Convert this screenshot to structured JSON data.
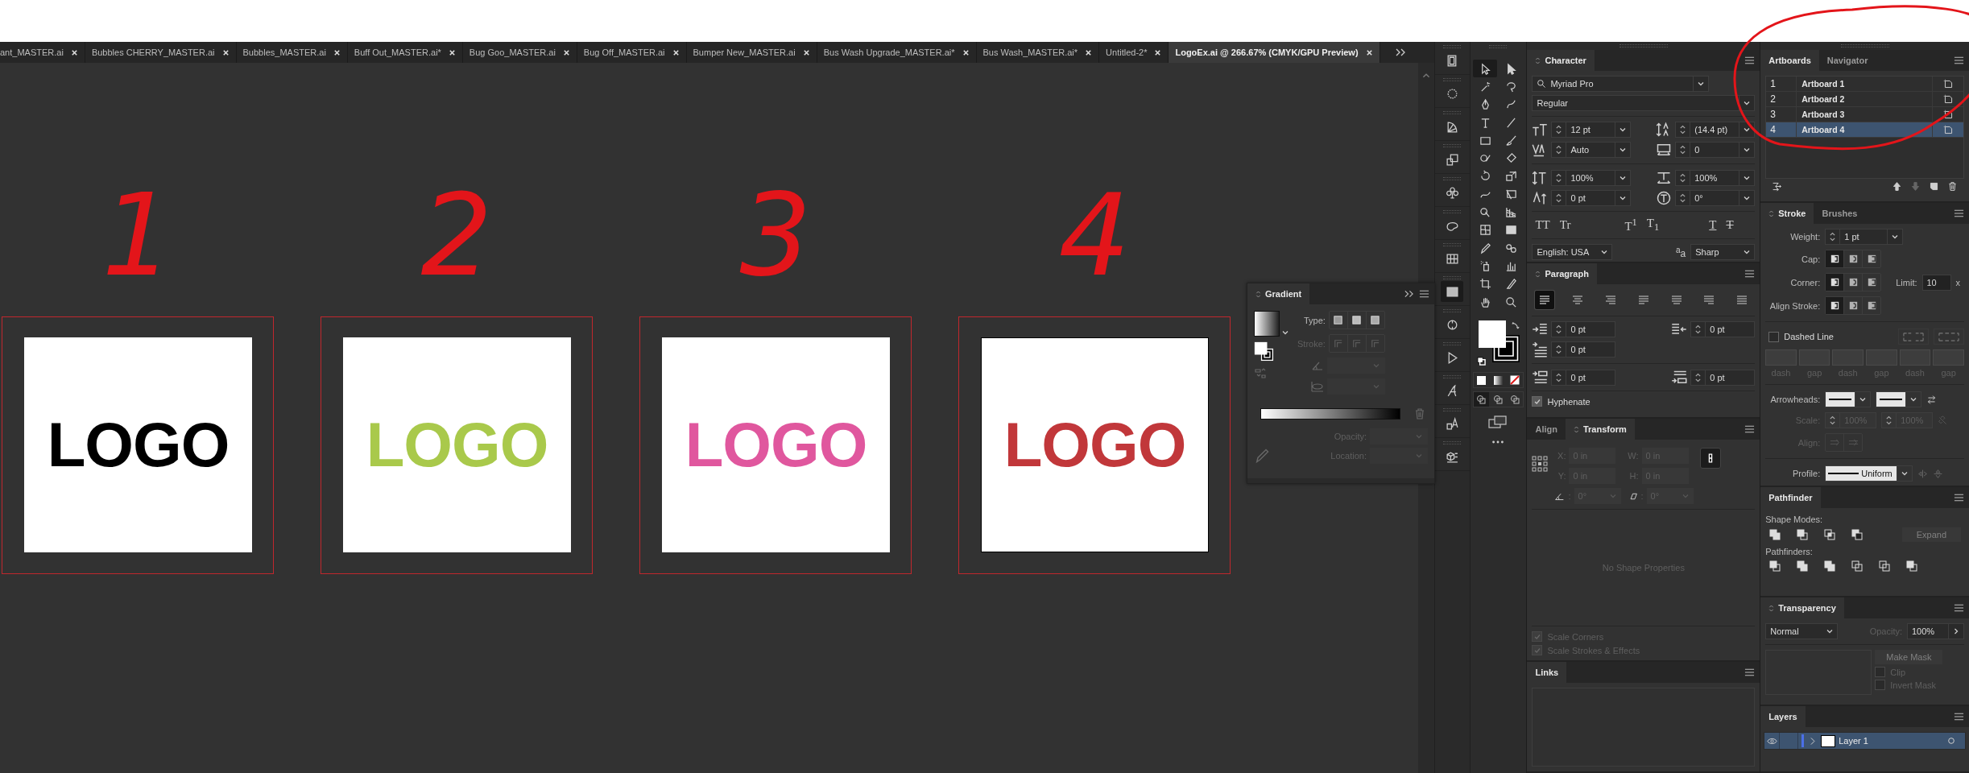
{
  "tabs": [
    {
      "label": "ant_MASTER.ai",
      "selected": false
    },
    {
      "label": "Bubbles CHERRY_MASTER.ai",
      "selected": false
    },
    {
      "label": "Bubbles_MASTER.ai",
      "selected": false
    },
    {
      "label": "Buff Out_MASTER.ai*",
      "selected": false
    },
    {
      "label": "Bug Goo_MASTER.ai",
      "selected": false
    },
    {
      "label": "Bug Off_MASTER.ai",
      "selected": false
    },
    {
      "label": "Bumper New_MASTER.ai",
      "selected": false
    },
    {
      "label": "Bus Wash Upgrade_MASTER.ai*",
      "selected": false
    },
    {
      "label": "Bus Wash_MASTER.ai*",
      "selected": false
    },
    {
      "label": "Untitled-2*",
      "selected": false
    },
    {
      "label": "LogoEx.ai @ 266.67% (CMYK/GPU Preview)",
      "selected": true
    }
  ],
  "canvas": {
    "artboards": [
      {
        "annotation": "1",
        "logo": "LOGO",
        "color": "#000000",
        "selected": false
      },
      {
        "annotation": "2",
        "logo": "LOGO",
        "color": "#a9c94b",
        "selected": false
      },
      {
        "annotation": "3",
        "logo": "LOGO",
        "color": "#e0579e",
        "selected": false
      },
      {
        "annotation": "4",
        "logo": "LOGO",
        "color": "#c1373a",
        "selected": true
      }
    ]
  },
  "gradient": {
    "title": "Gradient",
    "rows": [
      {
        "label": "Type:",
        "disabled": false
      },
      {
        "label": "Stroke:",
        "disabled": true
      }
    ],
    "stops": [
      {
        "label": "Opacity:",
        "disabled": true
      },
      {
        "label": "Location:",
        "disabled": true
      }
    ]
  },
  "dock": [
    {
      "selected": false
    },
    {
      "selected": false
    },
    {
      "selected": false
    },
    {
      "selected": false
    },
    {
      "selected": false
    },
    {
      "selected": false
    },
    {
      "selected": false
    },
    {
      "selected": true
    },
    {
      "selected": false
    },
    {
      "selected": false
    },
    {
      "selected": false
    },
    {
      "selected": false
    },
    {
      "selected": false
    }
  ],
  "tools": [
    {
      "selected": true
    },
    {
      "selected": false
    },
    {
      "selected": false
    },
    {
      "selected": false
    },
    {
      "selected": false
    },
    {
      "selected": false
    },
    {
      "selected": false
    },
    {
      "selected": false
    },
    {
      "selected": false
    },
    {
      "selected": false
    },
    {
      "selected": false
    },
    {
      "selected": false
    },
    {
      "selected": false
    },
    {
      "selected": false
    },
    {
      "selected": false
    },
    {
      "selected": false
    },
    {
      "selected": false
    },
    {
      "selected": false
    },
    {
      "selected": false
    },
    {
      "selected": false
    },
    {
      "selected": false
    },
    {
      "selected": false
    },
    {
      "selected": false
    },
    {
      "selected": false
    },
    {
      "selected": false
    },
    {
      "selected": false
    },
    {
      "selected": false
    },
    {
      "selected": false
    }
  ],
  "character": {
    "title": "Character",
    "font": "Myriad Pro",
    "style": "Regular",
    "fields": [
      {
        "kind": "size",
        "value": "12 pt"
      },
      {
        "kind": "leading",
        "value": "(14.4 pt)"
      },
      {
        "kind": "kerning",
        "value": "Auto"
      },
      {
        "kind": "tracking",
        "value": "0"
      },
      {
        "kind": "vscale",
        "value": "100%"
      },
      {
        "kind": "hscale",
        "value": "100%"
      },
      {
        "kind": "baseline",
        "value": "0 pt"
      },
      {
        "kind": "rotation",
        "value": "0°"
      }
    ],
    "styles": [
      {
        "label": "TT",
        "kind": "plain"
      },
      {
        "label": "Tr",
        "kind": "plain"
      },
      {
        "label": "T$^{1}$",
        "kind": "plain"
      },
      {
        "label": "T$_{1}$",
        "kind": "plain"
      },
      {
        "label": "T",
        "kind": "underline"
      },
      {
        "label": "T",
        "kind": "strike"
      }
    ],
    "language": "English: USA",
    "antialias_mark": "$^{a}$a",
    "antialias": "Sharp"
  },
  "paragraph": {
    "title": "Paragraph",
    "align": [
      {
        "selected": true
      },
      {
        "selected": false
      },
      {
        "selected": false
      },
      {
        "selected": false
      },
      {
        "selected": false
      },
      {
        "selected": false
      },
      {
        "selected": false
      }
    ],
    "fields": [
      {
        "kind": "left",
        "value": "0 pt"
      },
      {
        "kind": "right",
        "value": "0 pt"
      },
      {
        "kind": "first",
        "value": "0 pt"
      },
      {
        "kind": "before",
        "value": "0 pt"
      },
      {
        "kind": "after",
        "value": "0 pt"
      }
    ],
    "hyphenate": {
      "label": "Hyphenate",
      "checked": true
    }
  },
  "transform": {
    "tabs": [
      {
        "label": "Align",
        "selected": false
      },
      {
        "label": "Transform",
        "selected": true
      }
    ],
    "disabled": true,
    "fields": [
      {
        "label": "X:",
        "value": "0 in"
      },
      {
        "label": "W:",
        "value": "0 in"
      },
      {
        "label": "Y:",
        "value": "0 in"
      },
      {
        "label": "H:",
        "value": "0 in"
      }
    ],
    "angles": [
      {
        "kind": "rotate",
        "label": ":",
        "value": "0°"
      },
      {
        "kind": "shear",
        "label": ":",
        "value": "0°"
      }
    ],
    "message": "No Shape Properties",
    "options": [
      {
        "label": "Scale Corners",
        "checked": true
      },
      {
        "label": "Scale Strokes & Effects",
        "checked": true
      }
    ]
  },
  "links": {
    "title": "Links"
  },
  "artboards": {
    "tabs": [
      {
        "label": "Artboards",
        "selected": true
      },
      {
        "label": "Navigator",
        "selected": false
      }
    ],
    "rows": [
      {
        "number": "1",
        "name": "Artboard 1",
        "selected": false
      },
      {
        "number": "2",
        "name": "Artboard 2",
        "selected": false
      },
      {
        "number": "3",
        "name": "Artboard 3",
        "selected": false
      },
      {
        "number": "4",
        "name": "Artboard 4",
        "selected": true
      }
    ]
  },
  "stroke": {
    "tabs": [
      {
        "label": "Stroke",
        "selected": true
      },
      {
        "label": "Brushes",
        "selected": false
      }
    ],
    "weight_label": "Weight:",
    "weight": "1 pt",
    "cap_label": "Cap:",
    "caps": [
      {
        "selected": true
      },
      {
        "selected": false
      },
      {
        "selected": false
      }
    ],
    "corner_label": "Corner:",
    "corners": [
      {
        "selected": true
      },
      {
        "selected": false
      },
      {
        "selected": false
      }
    ],
    "limit_label": "Limit:",
    "limit": "10",
    "limit_unit": "x",
    "align_label": "Align Stroke:",
    "aligns": [
      {
        "selected": true
      },
      {
        "selected": false
      },
      {
        "selected": false
      }
    ],
    "dashed": {
      "label": "Dashed Line",
      "checked": false
    },
    "dashes": [
      {
        "label": "dash",
        "disabled": true
      },
      {
        "label": "gap",
        "disabled": true
      },
      {
        "label": "dash",
        "disabled": true
      },
      {
        "label": "gap",
        "disabled": true
      },
      {
        "label": "dash",
        "disabled": true
      },
      {
        "label": "gap",
        "disabled": true
      }
    ],
    "arrowheads_label": "Arrowheads:",
    "scale": {
      "label": "Scale:",
      "values": [
        "100%",
        "100%"
      ],
      "disabled": true
    },
    "arrow_align": {
      "label": "Align:",
      "disabled": true
    },
    "profile_label": "Profile:",
    "profile": "Uniform"
  },
  "pathfinder": {
    "title": "Pathfinder",
    "shape_modes_label": "Shape Modes:",
    "expand": {
      "label": "Expand",
      "disabled": true
    },
    "pathfinders_label": "Pathfinders:"
  },
  "transparency": {
    "title": "Transparency",
    "mode": "Normal",
    "opacity_label": "Opacity:",
    "opacity": "100%",
    "make_mask": {
      "label": "Make Mask",
      "disabled": true
    },
    "options": [
      {
        "label": "Clip",
        "checked": false,
        "disabled": true
      },
      {
        "label": "Invert Mask",
        "checked": false,
        "disabled": true
      }
    ]
  },
  "layers": {
    "title": "Layers",
    "rows": [
      {
        "name": "Layer 1",
        "selected": true,
        "color": "#4b6fe8"
      }
    ]
  }
}
